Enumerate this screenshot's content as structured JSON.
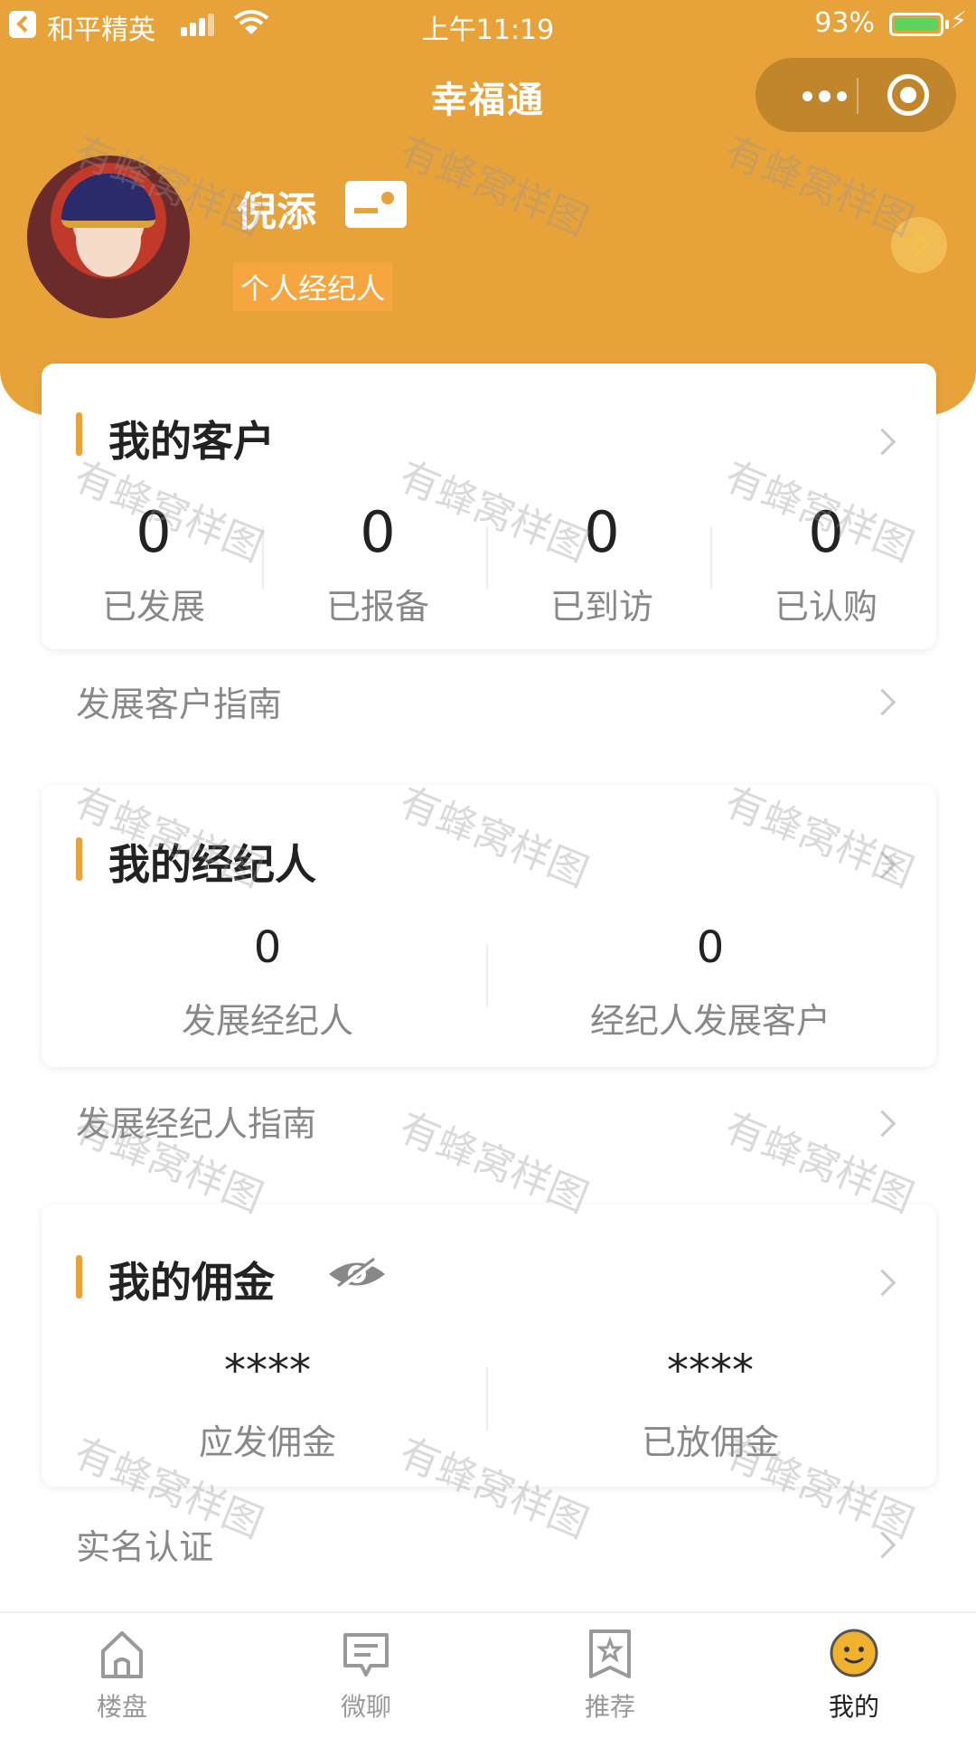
{
  "status_bar": {
    "carrier": "和平精英",
    "time": "上午11:19",
    "battery": "93%"
  },
  "nav": {
    "title": "幸福通"
  },
  "profile": {
    "name": "倪添",
    "role": "个人经纪人"
  },
  "customers": {
    "title": "我的客户",
    "stats": [
      {
        "value": "0",
        "label": "已发展"
      },
      {
        "value": "0",
        "label": "已报备"
      },
      {
        "value": "0",
        "label": "已到访"
      },
      {
        "value": "0",
        "label": "已认购"
      }
    ]
  },
  "customer_guide": "发展客户指南",
  "agents": {
    "title": "我的经纪人",
    "stats": [
      {
        "value": "0",
        "label": "发展经纪人"
      },
      {
        "value": "0",
        "label": "经纪人发展客户"
      }
    ]
  },
  "agent_guide": "发展经纪人指南",
  "commission": {
    "title": "我的佣金",
    "stats": [
      {
        "value": "****",
        "label": "应发佣金"
      },
      {
        "value": "****",
        "label": "已放佣金"
      }
    ]
  },
  "verification": "实名认证",
  "watermark": "有蜂窝样图",
  "tabs": [
    {
      "label": "楼盘",
      "icon": "home-icon"
    },
    {
      "label": "微聊",
      "icon": "chat-icon"
    },
    {
      "label": "推荐",
      "icon": "star-bookmark-icon"
    },
    {
      "label": "我的",
      "icon": "smiley-face-icon"
    }
  ],
  "colors": {
    "accent": "#e8a23a",
    "bar": "#eca23c",
    "battery": "#5fd35f"
  }
}
